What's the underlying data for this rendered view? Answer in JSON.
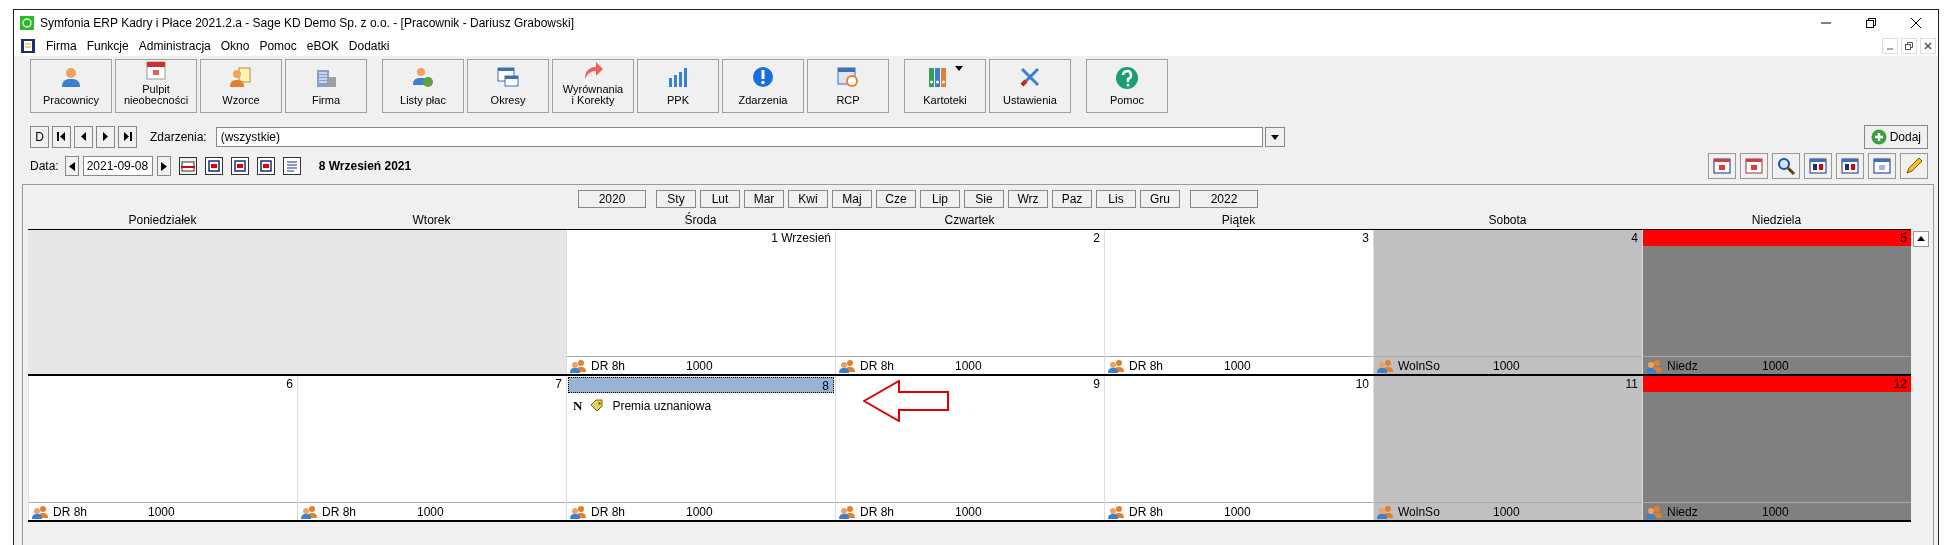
{
  "window": {
    "title": "Symfonia ERP Kadry i Płace 2021.2.a - Sage KD Demo Sp. z o.o. - [Pracownik - Dariusz Grabowski]"
  },
  "menu": [
    "Firma",
    "Funkcje",
    "Administracja",
    "Okno",
    "Pomoc",
    "eBOK",
    "Dodatki"
  ],
  "toolbar": [
    [
      {
        "label": "Pracownicy"
      },
      {
        "label": "Pulpit\nnieobecności"
      },
      {
        "label": "Wzorce"
      },
      {
        "label": "Firma"
      }
    ],
    [
      {
        "label": "Listy płac"
      },
      {
        "label": "Okresy"
      },
      {
        "label": "Wyrównania\ni Korekty"
      },
      {
        "label": "PPK"
      },
      {
        "label": "Zdarzenia"
      },
      {
        "label": "RCP"
      }
    ],
    [
      {
        "label": "Kartoteki",
        "has_menu": true
      },
      {
        "label": "Ustawienia",
        "has_menu": false
      }
    ],
    [
      {
        "label": "Pomoc"
      }
    ]
  ],
  "nav": {
    "new_button": "D",
    "filter_label": "Zdarzenia:",
    "filter_value": "(wszystkie)",
    "add_button": "Dodaj"
  },
  "date_bar": {
    "label": "Data:",
    "value": "2021-09-08",
    "heading": "8 Wrzesień 2021"
  },
  "calendar": {
    "prev_year": "2020",
    "next_year": "2022",
    "months": [
      "Sty",
      "Lut",
      "Mar",
      "Kwi",
      "Maj",
      "Cze",
      "Lip",
      "Sie",
      "Wrz",
      "Paz",
      "Lis",
      "Gru"
    ],
    "weekdays": [
      "Poniedziałek",
      "Wtorek",
      "Środa",
      "Czwartek",
      "Piątek",
      "Sobota",
      "Niedziela"
    ],
    "weeks": [
      {
        "days": [
          {
            "kind": "blank"
          },
          {
            "kind": "blank"
          },
          {
            "kind": "workday",
            "date": "1 Wrzesień",
            "selected": false,
            "code": "DR 8h",
            "amount": "1000"
          },
          {
            "kind": "workday",
            "date": "2",
            "selected": false,
            "code": "DR 8h",
            "amount": "1000"
          },
          {
            "kind": "workday",
            "date": "3",
            "selected": false,
            "code": "DR 8h",
            "amount": "1000"
          },
          {
            "kind": "saturday",
            "date": "4",
            "selected": false,
            "code": "WolnSo",
            "amount": "1000"
          },
          {
            "kind": "sunday",
            "date": "5",
            "selected": false,
            "code": "Niedz",
            "amount": "1000"
          }
        ]
      },
      {
        "days": [
          {
            "kind": "workday",
            "date": "6",
            "selected": false,
            "code": "DR 8h",
            "amount": "1000"
          },
          {
            "kind": "workday",
            "date": "7",
            "selected": false,
            "code": "DR 8h",
            "amount": "1000"
          },
          {
            "kind": "workday",
            "date": "8",
            "selected": true,
            "code": "DR 8h",
            "amount": "1000",
            "events": [
              {
                "marker": "N",
                "label": "Premia uznaniowa"
              }
            ]
          },
          {
            "kind": "workday",
            "date": "9",
            "selected": false,
            "code": "DR 8h",
            "amount": "1000"
          },
          {
            "kind": "workday",
            "date": "10",
            "selected": false,
            "code": "DR 8h",
            "amount": "1000"
          },
          {
            "kind": "saturday",
            "date": "11",
            "selected": false,
            "code": "WolnSo",
            "amount": "1000"
          },
          {
            "kind": "sunday",
            "date": "12",
            "selected": false,
            "code": "Niedz",
            "amount": "1000"
          }
        ]
      }
    ]
  }
}
